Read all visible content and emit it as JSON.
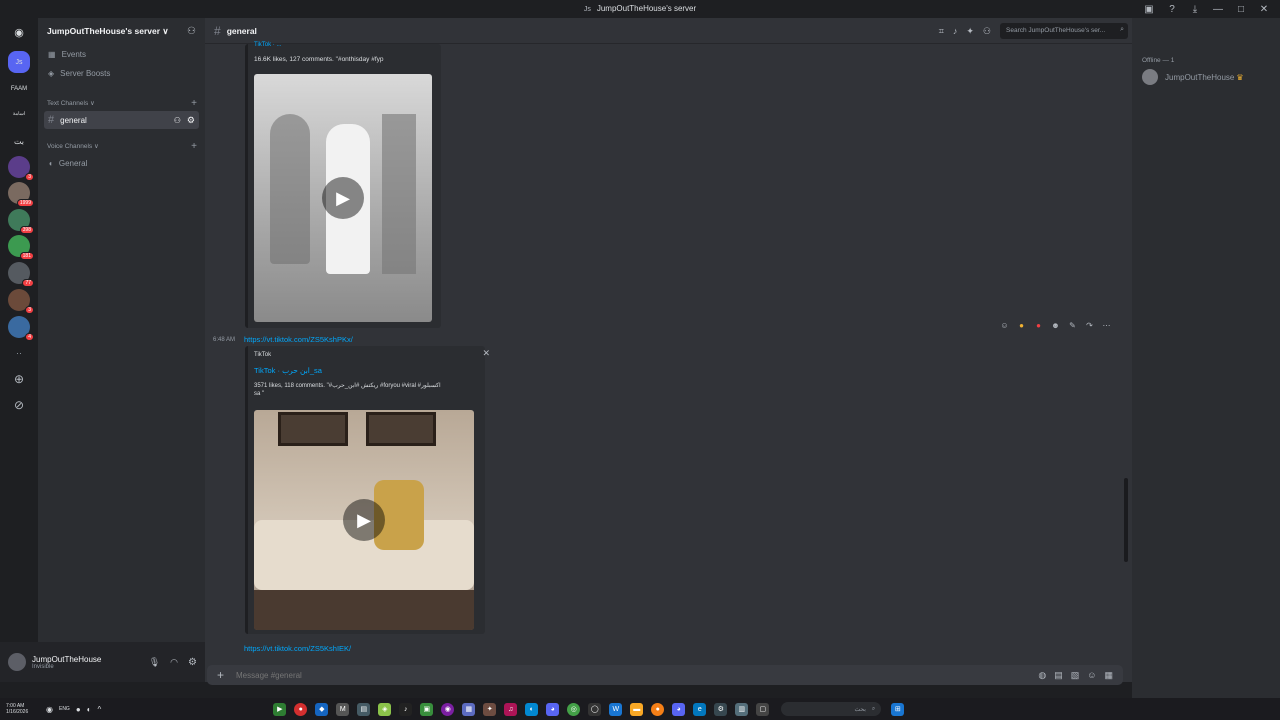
{
  "window": {
    "title": "JumpOutTheHouse's server",
    "icon": "Js"
  },
  "server": {
    "name": "JumpOutTheHouse's server ∨"
  },
  "sidebar": {
    "events": "Events",
    "boosts": "Server Boosts",
    "text_category": "Text Channels ∨",
    "voice_category": "Voice Channels ∨",
    "text_channel": "general",
    "voice_channel": "General"
  },
  "rail": {
    "active_server": "Js",
    "faam": "FAAM",
    "badges": [
      "3",
      "1999",
      "398",
      "181",
      "77",
      "3",
      "4"
    ]
  },
  "channel": {
    "name": "general",
    "search_placeholder": "Search JumpOutTheHouse's ser..."
  },
  "messages": {
    "embed1_provider": "TikTok · ...",
    "embed1_stats": "16.6K likes, 127 comments. \"#onthisday #fyp",
    "embed2_time": "6:48 AM",
    "embed2_link": "https://vt.tiktok.com/ZS5KshPKx/",
    "embed2_provider": "TikTok",
    "embed2_author": "TikTok · ابن حرب_sa",
    "embed2_stats": "3571 likes, 118 comments. \"#ريكتش #ابن_حرب #foryou #viral #اكسبلور",
    "embed2_stats2": "sa \"",
    "embed3_link": "https://vt.tiktok.com/ZS5KshIEK/"
  },
  "composer": {
    "placeholder": "Message #general"
  },
  "members": {
    "header": "Offline — 1",
    "user": "JumpOutTheHouse"
  },
  "user_panel": {
    "name": "JumpOutTheHouse",
    "status": "Invisible"
  },
  "taskbar": {
    "time": "7:00 AM",
    "date": "1/16/2026",
    "lang": "ENG",
    "search": "بحث"
  }
}
